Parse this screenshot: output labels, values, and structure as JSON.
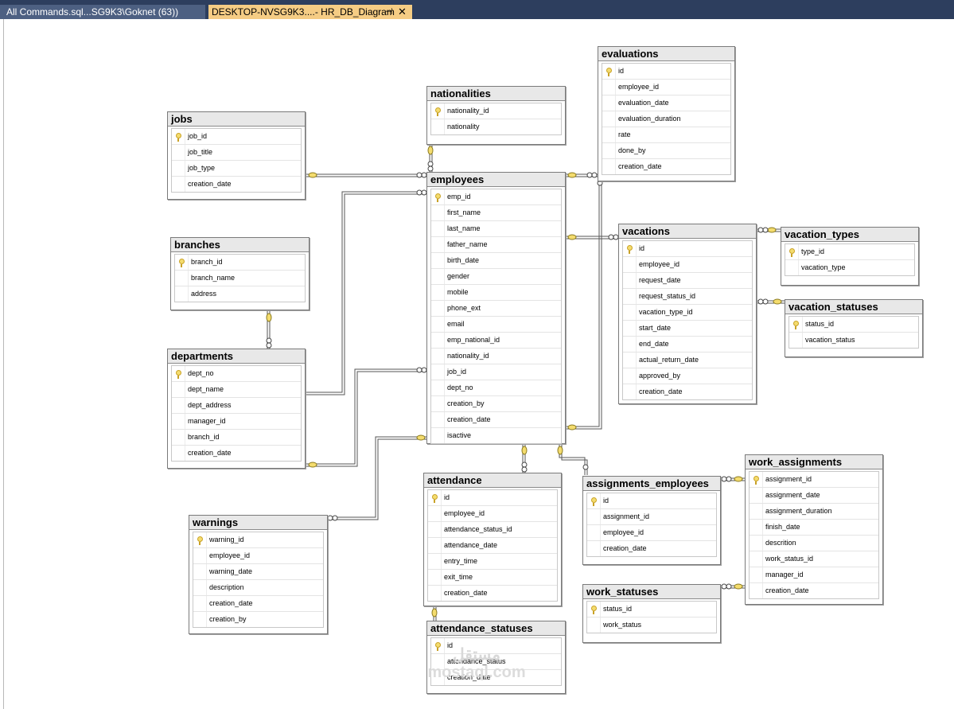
{
  "tabs": [
    {
      "label": "All Commands.sql...SG9K3\\Goknet (63))",
      "active": false
    },
    {
      "label": "DESKTOP-NVSG9K3....- HR_DB_Diagram",
      "active": true
    }
  ],
  "tab_icons": {
    "pin": "pin-icon",
    "close": "close-icon"
  },
  "tables": {
    "jobs": {
      "title": "jobs",
      "columns": [
        "job_id",
        "job_title",
        "job_type",
        "creation_date"
      ],
      "pk": [
        0
      ]
    },
    "branches": {
      "title": "branches",
      "columns": [
        "branch_id",
        "branch_name",
        "address"
      ],
      "pk": [
        0
      ]
    },
    "departments": {
      "title": "departments",
      "columns": [
        "dept_no",
        "dept_name",
        "dept_address",
        "manager_id",
        "branch_id",
        "creation_date"
      ],
      "pk": [
        0
      ]
    },
    "warnings": {
      "title": "warnings",
      "columns": [
        "warning_id",
        "employee_id",
        "warning_date",
        "description",
        "creation_date",
        "creation_by"
      ],
      "pk": [
        0
      ]
    },
    "nationalities": {
      "title": "nationalities",
      "columns": [
        "nationality_id",
        "nationality"
      ],
      "pk": [
        0
      ]
    },
    "employees": {
      "title": "employees",
      "columns": [
        "emp_id",
        "first_name",
        "last_name",
        "father_name",
        "birth_date",
        "gender",
        "mobile",
        "phone_ext",
        "email",
        "emp_national_id",
        "nationality_id",
        "job_id",
        "dept_no",
        "creation_by",
        "creation_date",
        "isactive"
      ],
      "pk": [
        0
      ]
    },
    "attendance": {
      "title": "attendance",
      "columns": [
        "id",
        "employee_id",
        "attendance_status_id",
        "attendance_date",
        "entry_time",
        "exit_time",
        "creation_date"
      ],
      "pk": [
        0
      ]
    },
    "attendance_statuses": {
      "title": "attendance_statuses",
      "columns": [
        "id",
        "attendance_status",
        "creation_date"
      ],
      "pk": [
        0
      ]
    },
    "evaluations": {
      "title": "evaluations",
      "columns": [
        "id",
        "employee_id",
        "evaluation_date",
        "evaluation_duration",
        "rate",
        "done_by",
        "creation_date"
      ],
      "pk": [
        0
      ]
    },
    "vacations": {
      "title": "vacations",
      "columns": [
        "id",
        "employee_id",
        "request_date",
        "request_status_id",
        "vacation_type_id",
        "start_date",
        "end_date",
        "actual_return_date",
        "approved_by",
        "creation_date"
      ],
      "pk": [
        0
      ]
    },
    "vacation_types": {
      "title": "vacation_types",
      "columns": [
        "type_id",
        "vacation_type"
      ],
      "pk": [
        0
      ]
    },
    "vacation_statuses": {
      "title": "vacation_statuses",
      "columns": [
        "status_id",
        "vacation_status"
      ],
      "pk": [
        0
      ]
    },
    "assignments_employees": {
      "title": "assignments_employees",
      "columns": [
        "id",
        "assignment_id",
        "employee_id",
        "creation_date"
      ],
      "pk": [
        0
      ]
    },
    "work_assignments": {
      "title": "work_assignments",
      "columns": [
        "assignment_id",
        "assignment_date",
        "assignment_duration",
        "finish_date",
        "descrition",
        "work_status_id",
        "manager_id",
        "creation_date"
      ],
      "pk": [
        0
      ]
    },
    "work_statuses": {
      "title": "work_statuses",
      "columns": [
        "status_id",
        "work_status"
      ],
      "pk": [
        0
      ]
    }
  },
  "relationships": [
    {
      "from": "jobs",
      "to": "employees"
    },
    {
      "from": "nationalities",
      "to": "employees"
    },
    {
      "from": "employees",
      "to": "evaluations"
    },
    {
      "from": "employees",
      "to": "vacations"
    },
    {
      "from": "vacation_types",
      "to": "vacations"
    },
    {
      "from": "vacation_statuses",
      "to": "vacations"
    },
    {
      "from": "departments",
      "to": "employees"
    },
    {
      "from": "branches",
      "to": "departments"
    },
    {
      "from": "employees",
      "to": "warnings"
    },
    {
      "from": "employees",
      "to": "attendance"
    },
    {
      "from": "attendance_statuses",
      "to": "attendance"
    },
    {
      "from": "employees",
      "to": "assignments_employees"
    },
    {
      "from": "work_assignments",
      "to": "assignments_employees"
    },
    {
      "from": "work_statuses",
      "to": "work_assignments"
    }
  ],
  "watermark": {
    "arabic": "مستقل",
    "latin": "mostaql.com"
  }
}
